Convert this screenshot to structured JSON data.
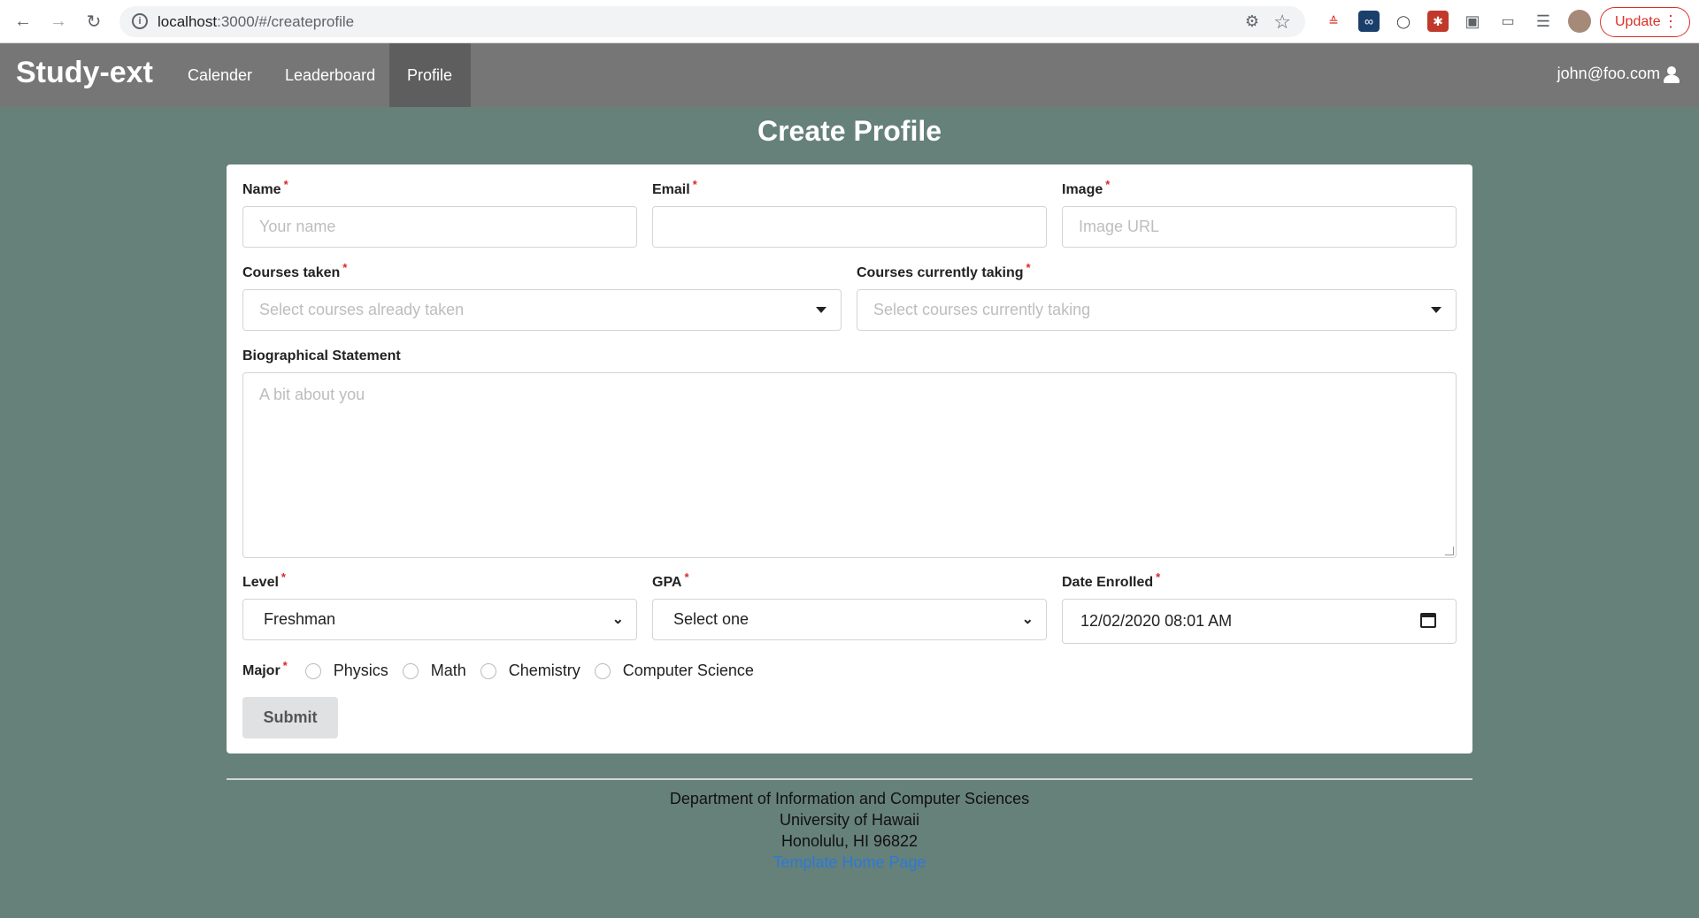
{
  "browser": {
    "url_host": "localhost",
    "url_path": ":3000/#/createprofile",
    "update_label": "Update"
  },
  "nav": {
    "brand": "Study-ext",
    "items": [
      {
        "label": "Calender"
      },
      {
        "label": "Leaderboard"
      },
      {
        "label": "Profile",
        "active": true
      }
    ],
    "user": "john@foo.com"
  },
  "page": {
    "title": "Create Profile"
  },
  "form": {
    "name": {
      "label": "Name",
      "placeholder": "Your name"
    },
    "email": {
      "label": "Email",
      "placeholder": ""
    },
    "image": {
      "label": "Image",
      "placeholder": "Image URL"
    },
    "courses_taken": {
      "label": "Courses taken",
      "placeholder": "Select courses already taken"
    },
    "courses_current": {
      "label": "Courses currently taking",
      "placeholder": "Select courses currently taking"
    },
    "bio": {
      "label": "Biographical Statement",
      "placeholder": "A bit about you"
    },
    "level": {
      "label": "Level",
      "value": "Freshman"
    },
    "gpa": {
      "label": "GPA",
      "value": "Select one"
    },
    "date_enrolled": {
      "label": "Date Enrolled",
      "value": "12/02/2020 08:01 AM"
    },
    "major": {
      "label": "Major",
      "options": [
        "Physics",
        "Math",
        "Chemistry",
        "Computer Science"
      ]
    },
    "submit_label": "Submit",
    "required_mark": "*"
  },
  "footer": {
    "line1": "Department of Information and Computer Sciences",
    "line2": "University of Hawaii",
    "line3": "Honolulu, HI 96822",
    "link": "Template Home Page"
  },
  "colors": {
    "background": "#66807a",
    "navbar": "#767676",
    "required": "#db2828",
    "update": "#d93025"
  }
}
